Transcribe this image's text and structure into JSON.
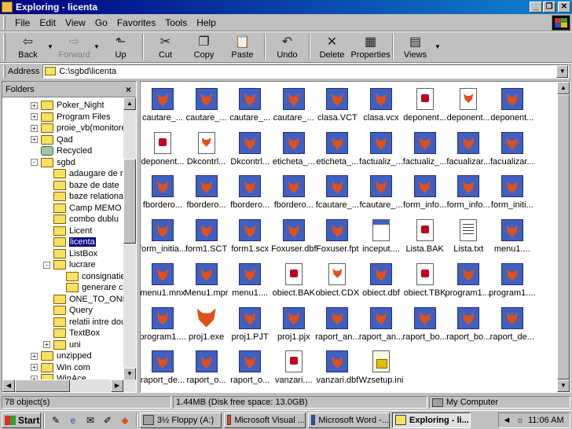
{
  "window": {
    "title": "Exploring - licenta",
    "buttons": [
      "_",
      "❐",
      "✕"
    ]
  },
  "menu": [
    "File",
    "Edit",
    "View",
    "Go",
    "Favorites",
    "Tools",
    "Help"
  ],
  "toolbar": [
    {
      "label": "Back",
      "icon": "back-arrow-icon",
      "glyph": "⇦",
      "disabled": false,
      "dropdown": true
    },
    {
      "label": "Forward",
      "icon": "forward-arrow-icon",
      "glyph": "⇨",
      "disabled": true,
      "dropdown": true
    },
    {
      "label": "Up",
      "icon": "up-folder-icon",
      "glyph": "⬑",
      "disabled": false
    },
    {
      "label": "Cut",
      "icon": "scissors-icon",
      "glyph": "✂",
      "disabled": false
    },
    {
      "label": "Copy",
      "icon": "copy-icon",
      "glyph": "❐",
      "disabled": false
    },
    {
      "label": "Paste",
      "icon": "paste-icon",
      "glyph": "📋",
      "disabled": false
    },
    {
      "label": "Undo",
      "icon": "undo-icon",
      "glyph": "↶",
      "disabled": false
    },
    {
      "label": "Delete",
      "icon": "delete-x-icon",
      "glyph": "✕",
      "disabled": false
    },
    {
      "label": "Properties",
      "icon": "properties-icon",
      "glyph": "▦",
      "disabled": false
    },
    {
      "label": "Views",
      "icon": "views-icon",
      "glyph": "▤",
      "disabled": false,
      "dropdown": true
    }
  ],
  "address": {
    "label": "Address",
    "value": "C:\\sgbd\\licenta"
  },
  "folders_pane": {
    "title": "Folders",
    "close": "×",
    "tree": [
      {
        "label": "Poker_Night",
        "indent": 1,
        "pm": "+"
      },
      {
        "label": "Program Files",
        "indent": 1,
        "pm": "+"
      },
      {
        "label": "proie_vb(monitore)",
        "indent": 1,
        "pm": "+"
      },
      {
        "label": "Qad",
        "indent": 1,
        "pm": "+"
      },
      {
        "label": "Recycled",
        "indent": 1,
        "pm": "",
        "icon": "recycle"
      },
      {
        "label": "sgbd",
        "indent": 1,
        "pm": "-"
      },
      {
        "label": "adaugare de nc",
        "indent": 2,
        "pm": ""
      },
      {
        "label": "baze de date",
        "indent": 2,
        "pm": ""
      },
      {
        "label": "baze relationale",
        "indent": 2,
        "pm": ""
      },
      {
        "label": "Camp MEMO",
        "indent": 2,
        "pm": ""
      },
      {
        "label": "combo dublu",
        "indent": 2,
        "pm": ""
      },
      {
        "label": "Licent",
        "indent": 2,
        "pm": ""
      },
      {
        "label": "licenta",
        "indent": 2,
        "pm": "",
        "selected": true
      },
      {
        "label": "ListBox",
        "indent": 2,
        "pm": ""
      },
      {
        "label": "lucrare",
        "indent": 2,
        "pm": "-"
      },
      {
        "label": "consignatie",
        "indent": 3,
        "pm": ""
      },
      {
        "label": "generare ca",
        "indent": 3,
        "pm": ""
      },
      {
        "label": "ONE_TO_ONE",
        "indent": 2,
        "pm": ""
      },
      {
        "label": "Query",
        "indent": 2,
        "pm": ""
      },
      {
        "label": "relatii intre doua",
        "indent": 2,
        "pm": ""
      },
      {
        "label": "TextBox",
        "indent": 2,
        "pm": ""
      },
      {
        "label": "uni",
        "indent": 2,
        "pm": "+"
      },
      {
        "label": "unzipped",
        "indent": 1,
        "pm": "+"
      },
      {
        "label": "Win com",
        "indent": 1,
        "pm": "+"
      },
      {
        "label": "WinAce",
        "indent": 1,
        "pm": "+"
      }
    ]
  },
  "files": [
    {
      "name": "cautare_...",
      "type": "fox"
    },
    {
      "name": "cautare_...",
      "type": "fox"
    },
    {
      "name": "cautare_...",
      "type": "fox"
    },
    {
      "name": "cautare_...",
      "type": "fox"
    },
    {
      "name": "clasa.VCT",
      "type": "fox"
    },
    {
      "name": "clasa.vcx",
      "type": "fox"
    },
    {
      "name": "deponent...",
      "type": "doc"
    },
    {
      "name": "deponent...",
      "type": "docfox"
    },
    {
      "name": "deponent...",
      "type": "fox"
    },
    {
      "name": "deponent...",
      "type": "doc"
    },
    {
      "name": "Dkcontrl...",
      "type": "docfox"
    },
    {
      "name": "Dkcontrl...",
      "type": "fox"
    },
    {
      "name": "eticheta_...",
      "type": "fox"
    },
    {
      "name": "eticheta_...",
      "type": "fox"
    },
    {
      "name": "factualiz_...",
      "type": "fox"
    },
    {
      "name": "factualiz_...",
      "type": "fox"
    },
    {
      "name": "facualizar...",
      "type": "fox"
    },
    {
      "name": "facualizar...",
      "type": "fox"
    },
    {
      "name": "fbordero...",
      "type": "fox"
    },
    {
      "name": "fbordero...",
      "type": "fox"
    },
    {
      "name": "fbordero...",
      "type": "fox"
    },
    {
      "name": "fbordero...",
      "type": "fox"
    },
    {
      "name": "fcautare_...",
      "type": "fox"
    },
    {
      "name": "fcautare_...",
      "type": "fox"
    },
    {
      "name": "form_info...",
      "type": "fox"
    },
    {
      "name": "form_info...",
      "type": "fox"
    },
    {
      "name": "form_initi...",
      "type": "fox"
    },
    {
      "name": "form_initia...",
      "type": "fox"
    },
    {
      "name": "form1.SCT",
      "type": "fox"
    },
    {
      "name": "form1.scx",
      "type": "fox"
    },
    {
      "name": "Foxuser.dbf",
      "type": "fox"
    },
    {
      "name": "Foxuser.fpt",
      "type": "fox"
    },
    {
      "name": "inceput....",
      "type": "bmp"
    },
    {
      "name": "Lista.BAK",
      "type": "doc"
    },
    {
      "name": "Lista.txt",
      "type": "txt"
    },
    {
      "name": "menu1....",
      "type": "fox"
    },
    {
      "name": "menu1.mnx",
      "type": "fox"
    },
    {
      "name": "Menu1.mpr",
      "type": "fox"
    },
    {
      "name": "menu1....",
      "type": "fox"
    },
    {
      "name": "obiect.BAK",
      "type": "doc"
    },
    {
      "name": "obiect.CDX",
      "type": "docfox"
    },
    {
      "name": "obiect.dbf",
      "type": "fox"
    },
    {
      "name": "obiect.TBK",
      "type": "doc"
    },
    {
      "name": "program1....",
      "type": "fox"
    },
    {
      "name": "program1....",
      "type": "fox"
    },
    {
      "name": "program1....",
      "type": "fox"
    },
    {
      "name": "proj1.exe",
      "type": "bigfox"
    },
    {
      "name": "proj1.PJT",
      "type": "fox"
    },
    {
      "name": "proj1.pjx",
      "type": "fox"
    },
    {
      "name": "raport_an...",
      "type": "fox"
    },
    {
      "name": "raport_an...",
      "type": "fox"
    },
    {
      "name": "raport_bo...",
      "type": "fox"
    },
    {
      "name": "raport_bo...",
      "type": "fox"
    },
    {
      "name": "raport_de...",
      "type": "fox"
    },
    {
      "name": "raport_de...",
      "type": "fox"
    },
    {
      "name": "raport_o...",
      "type": "fox"
    },
    {
      "name": "raport_o...",
      "type": "fox"
    },
    {
      "name": "vanzari....",
      "type": "doc"
    },
    {
      "name": "vanzari.dbf",
      "type": "fox"
    },
    {
      "name": "Wzsetup.ini",
      "type": "ini"
    }
  ],
  "status": {
    "objects": "78 object(s)",
    "size": "1.44MB (Disk free space: 13.0GB)",
    "location": "My Computer"
  },
  "taskbar": {
    "start": "Start",
    "tasks": [
      {
        "label": "3½ Floppy (A:)",
        "active": false
      },
      {
        "label": "Microsoft Visual ...",
        "active": false
      },
      {
        "label": "Microsoft Word -...",
        "active": false
      },
      {
        "label": "Exploring - li...",
        "active": true
      }
    ],
    "clock": "11:06 AM"
  },
  "colors": {
    "titlebar": "#000080",
    "selection": "#000080",
    "face": "#c0c0c0"
  }
}
